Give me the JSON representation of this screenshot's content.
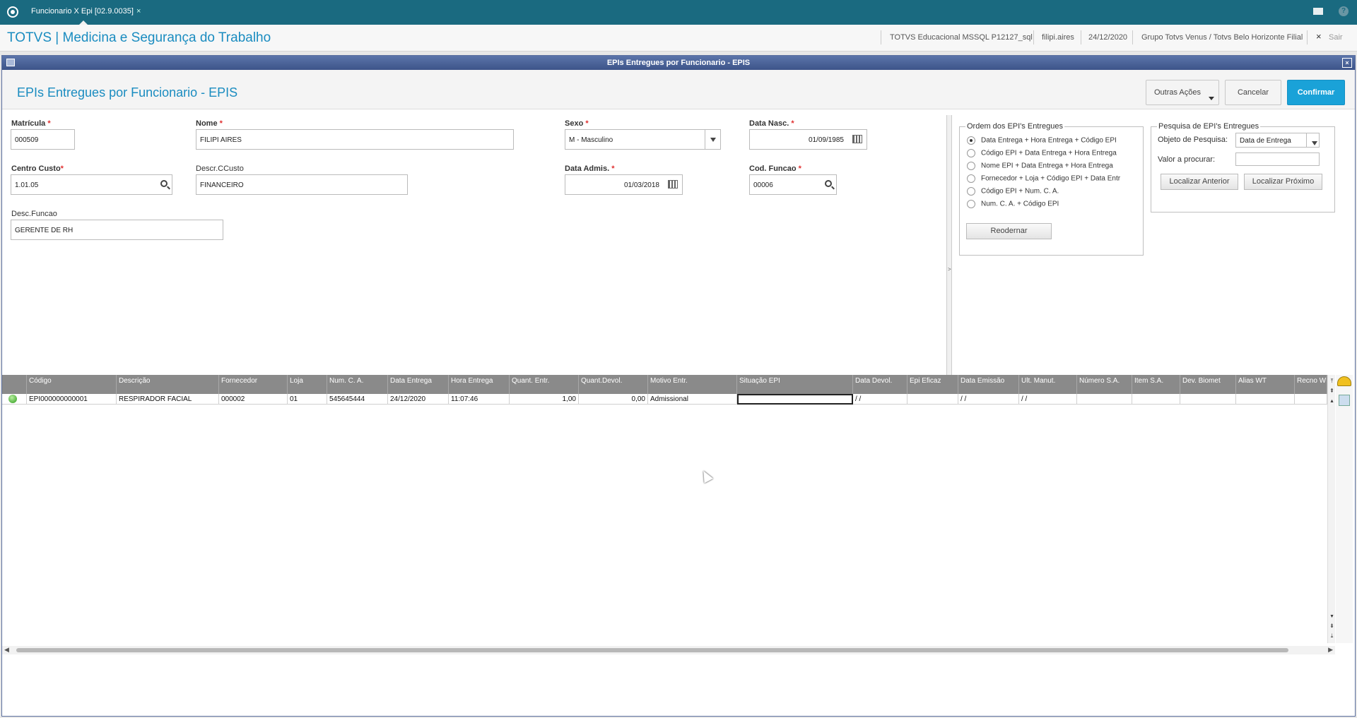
{
  "tab": {
    "label": "Funcionario X Epi [02.9.0035]",
    "close": "×"
  },
  "header": {
    "app_title": "TOTVS | Medicina e Segurança do Trabalho",
    "environment": "TOTVS Educacional MSSQL P12127_sql",
    "user": "filipi.aires",
    "date": "24/12/2020",
    "branch": "Grupo Totvs Venus / Totvs Belo Horizonte Filial",
    "exit_label": "Sair",
    "exit_icon": "×"
  },
  "window": {
    "title": "EPIs Entregues por Funcionario - EPIS",
    "form_title": "EPIs Entregues por Funcionario - EPIS",
    "close": "×",
    "actions": {
      "other": "Outras Ações",
      "cancel": "Cancelar",
      "confirm": "Confirmar"
    }
  },
  "form": {
    "matricula": {
      "label": "Matrícula",
      "value": "000509"
    },
    "nome": {
      "label": "Nome",
      "value": "FILIPI AIRES"
    },
    "sexo": {
      "label": "Sexo",
      "value": "M - Masculino"
    },
    "data_nasc": {
      "label": "Data Nasc.",
      "value": "01/09/1985"
    },
    "centro_custo": {
      "label": "Centro Custo",
      "value": "1.01.05"
    },
    "descr_ccusto": {
      "label": "Descr.CCusto",
      "value": "FINANCEIRO"
    },
    "data_admis": {
      "label": "Data Admis.",
      "value": "01/03/2018"
    },
    "cod_funcao": {
      "label": "Cod. Funcao",
      "value": "00006"
    },
    "desc_funcao": {
      "label": "Desc.Funcao",
      "value": "GERENTE DE RH"
    },
    "required_mark": "*"
  },
  "splitter_glyph": ">",
  "ordem": {
    "title": "Ordem dos EPI's Entregues",
    "options": [
      "Data Entrega + Hora Entrega + Código EPI",
      "Código EPI + Data Entrega + Hora Entrega",
      "Nome EPI + Data Entrega + Hora Entrega",
      "Fornecedor + Loja + Código EPI + Data Entr",
      "Código EPI +  Num. C. A.",
      "Num. C. A. + Código EPI"
    ],
    "selected_index": 0,
    "reorder_label": "Reodernar"
  },
  "pesquisa": {
    "title": "Pesquisa de EPI's Entregues",
    "object_label": "Objeto de Pesquisa:",
    "object_value": "Data de Entrega",
    "value_label": "Valor a procurar:",
    "value": "",
    "prev_label": "Localizar Anterior",
    "next_label": "Localizar Próximo"
  },
  "grid": {
    "columns": [
      "Código",
      "Descrição",
      "Fornecedor",
      "Loja",
      "Num. C. A.",
      "Data Entrega",
      "Hora Entrega",
      "Quant. Entr.",
      "Quant.Devol.",
      "Motivo Entr.",
      "Situação EPI",
      "Data Devol.",
      "Epi Eficaz",
      "Data Emissão",
      "Ult. Manut.",
      "Número S.A.",
      "Item S.A.",
      "Dev. Biomet",
      "Alias WT",
      "Recno W"
    ],
    "rows": [
      [
        "EPI000000000001",
        "RESPIRADOR FACIAL",
        "000002",
        "01",
        "545645444",
        "24/12/2020",
        "11:07:46",
        "1,00",
        "0,00",
        "Admissional",
        "",
        " /  /",
        "",
        " /  /",
        " /  /",
        "",
        "",
        "",
        "",
        ""
      ]
    ],
    "row_status_color": "#2c9a1a"
  },
  "colors": {
    "brand": "#1a8cc0",
    "topbar": "#1a6a80",
    "confirm": "#1aa2d8",
    "window_title": "#3d5489"
  },
  "icons": [
    "app-logo-icon",
    "mail-icon",
    "help-icon",
    "search-icon",
    "calendar-icon",
    "dropdown-arrow-icon",
    "helmet-icon",
    "document-icon"
  ]
}
